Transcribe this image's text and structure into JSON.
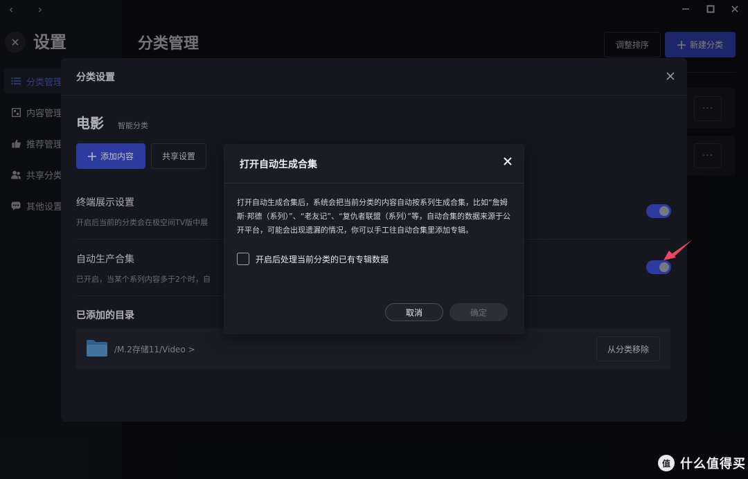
{
  "window": {
    "back_glyph": "‹",
    "forward_glyph": "›"
  },
  "sidebar": {
    "title": "设置",
    "items": [
      {
        "label": "分类管理",
        "icon": "list-icon",
        "active": true
      },
      {
        "label": "内容管理",
        "icon": "grid-icon",
        "active": false
      },
      {
        "label": "推荐管理",
        "icon": "thumbs-up-icon",
        "active": false
      },
      {
        "label": "共享分类",
        "icon": "users-icon",
        "active": false
      },
      {
        "label": "其他设置",
        "icon": "chat-dots-icon",
        "active": false
      }
    ]
  },
  "main": {
    "title": "分类管理",
    "reorder_label": "调整排序",
    "new_category_label": "新建分类",
    "more_glyph": "···"
  },
  "panel": {
    "title": "分类设置",
    "category_name": "电影",
    "category_type": "智能分类",
    "add_content_label": "添加内容",
    "share_settings_label": "共享设置",
    "terminal_display": {
      "title": "终端展示设置",
      "desc": "开启后当前的分类会在极空间TV版中展",
      "enabled": true
    },
    "auto_collection": {
      "title": "自动生产合集",
      "desc": "已开启，当某个系列内容多于2个时，自",
      "enabled": true
    },
    "dirs_title": "已添加的目录",
    "dirs": [
      {
        "path": "/M.2存储11/Video >",
        "remove_label": "从分类移除"
      }
    ]
  },
  "dialog": {
    "title": "打开自动生成合集",
    "body": "打开自动生成合集后，系统会把当前分类的内容自动按系列生成合集，比如“詹姆斯·邦德（系列）”、“老友记”、“复仇者联盟（系列）”等，自动合集的数据来源于公开平台，可能会出现遗漏的情况，你可以手工往自动合集里添加专辑。",
    "checkbox_label": "开启后处理当前分类的已有专辑数据",
    "checkbox_checked": false,
    "cancel_label": "取消",
    "confirm_label": "确定"
  },
  "watermark": {
    "logo_text": "值",
    "text": "什么值得买"
  },
  "colors": {
    "accent": "#3d4fd6",
    "active_text": "#6e7dff",
    "annotation_arrow": "#e8475f"
  }
}
